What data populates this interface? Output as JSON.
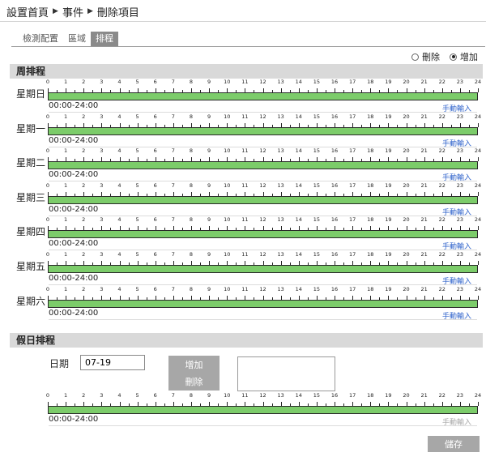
{
  "breadcrumb": {
    "home": "設置首頁",
    "event": "事件",
    "current": "刪除項目"
  },
  "tabs": [
    {
      "label": "檢測配置",
      "active": false
    },
    {
      "label": "區域",
      "active": false
    },
    {
      "label": "排程",
      "active": true
    }
  ],
  "mode": {
    "delete_label": "刪除",
    "add_label": "增加",
    "selected": "add"
  },
  "weekly": {
    "title": "周排程",
    "tick_labels": [
      "0",
      "1",
      "2",
      "3",
      "4",
      "5",
      "6",
      "7",
      "8",
      "9",
      "10",
      "11",
      "12",
      "13",
      "14",
      "15",
      "16",
      "17",
      "18",
      "19",
      "20",
      "21",
      "22",
      "23",
      "24"
    ],
    "days": [
      {
        "label": "星期日",
        "range": "00:00-24:00",
        "manual": "手動輸入"
      },
      {
        "label": "星期一",
        "range": "00:00-24:00",
        "manual": "手動輸入"
      },
      {
        "label": "星期二",
        "range": "00:00-24:00",
        "manual": "手動輸入"
      },
      {
        "label": "星期三",
        "range": "00:00-24:00",
        "manual": "手動輸入"
      },
      {
        "label": "星期四",
        "range": "00:00-24:00",
        "manual": "手動輸入"
      },
      {
        "label": "星期五",
        "range": "00:00-24:00",
        "manual": "手動輸入"
      },
      {
        "label": "星期六",
        "range": "00:00-24:00",
        "manual": "手動輸入"
      }
    ]
  },
  "holiday": {
    "title": "假日排程",
    "date_label": "日期",
    "date_value": "07-19",
    "add_label": "增加",
    "delete_label": "刪除",
    "range": "00:00-24:00",
    "manual": "手動輸入"
  },
  "save_label": "儲存",
  "colors": {
    "schedule_bar": "#7ccc6a",
    "link": "#3366cc",
    "button_gray": "#a7a7a7"
  }
}
